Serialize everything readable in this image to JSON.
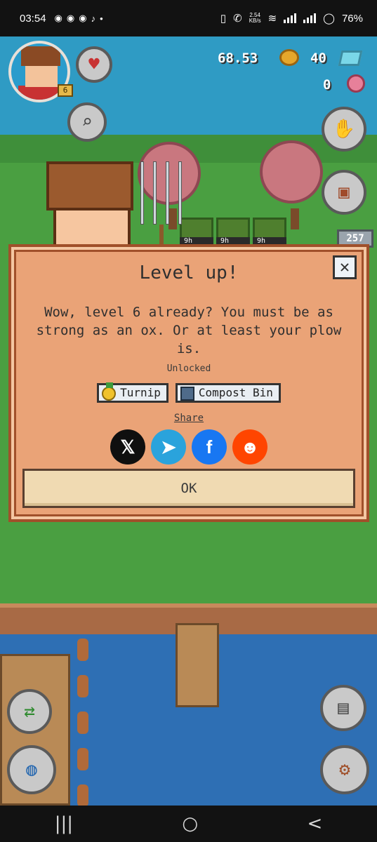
{
  "status_bar": {
    "time": "03:54",
    "notification_icons": [
      "discord-icon",
      "discord-icon",
      "discord-icon",
      "tiktok-icon",
      "dot"
    ],
    "net_speed_value": "2.54",
    "net_speed_unit": "KB/s",
    "battery": "76%"
  },
  "hud": {
    "player_level": "6",
    "coins": "68.53",
    "gems": "40",
    "flowers": "0",
    "inventory_count": "257"
  },
  "field": {
    "timers": [
      "9h",
      "9h",
      "9h"
    ]
  },
  "modal": {
    "title": "Level up!",
    "message": "Wow, level 6 already? You must be as strong as an ox. Or at least your plow is.",
    "unlocked_label": "Unlocked",
    "unlocks": [
      "Turnip",
      "Compost Bin"
    ],
    "share_label": "Share",
    "share_targets": [
      "X",
      "Telegram",
      "Facebook",
      "Reddit"
    ],
    "ok_label": "OK",
    "close_glyph": "✕"
  },
  "nav": {
    "recent": "|||",
    "home": "○",
    "back": "<"
  },
  "colors": {
    "modal_bg": "#eaa377",
    "modal_border": "#a0502a",
    "ok_bg": "#f0dab2"
  }
}
